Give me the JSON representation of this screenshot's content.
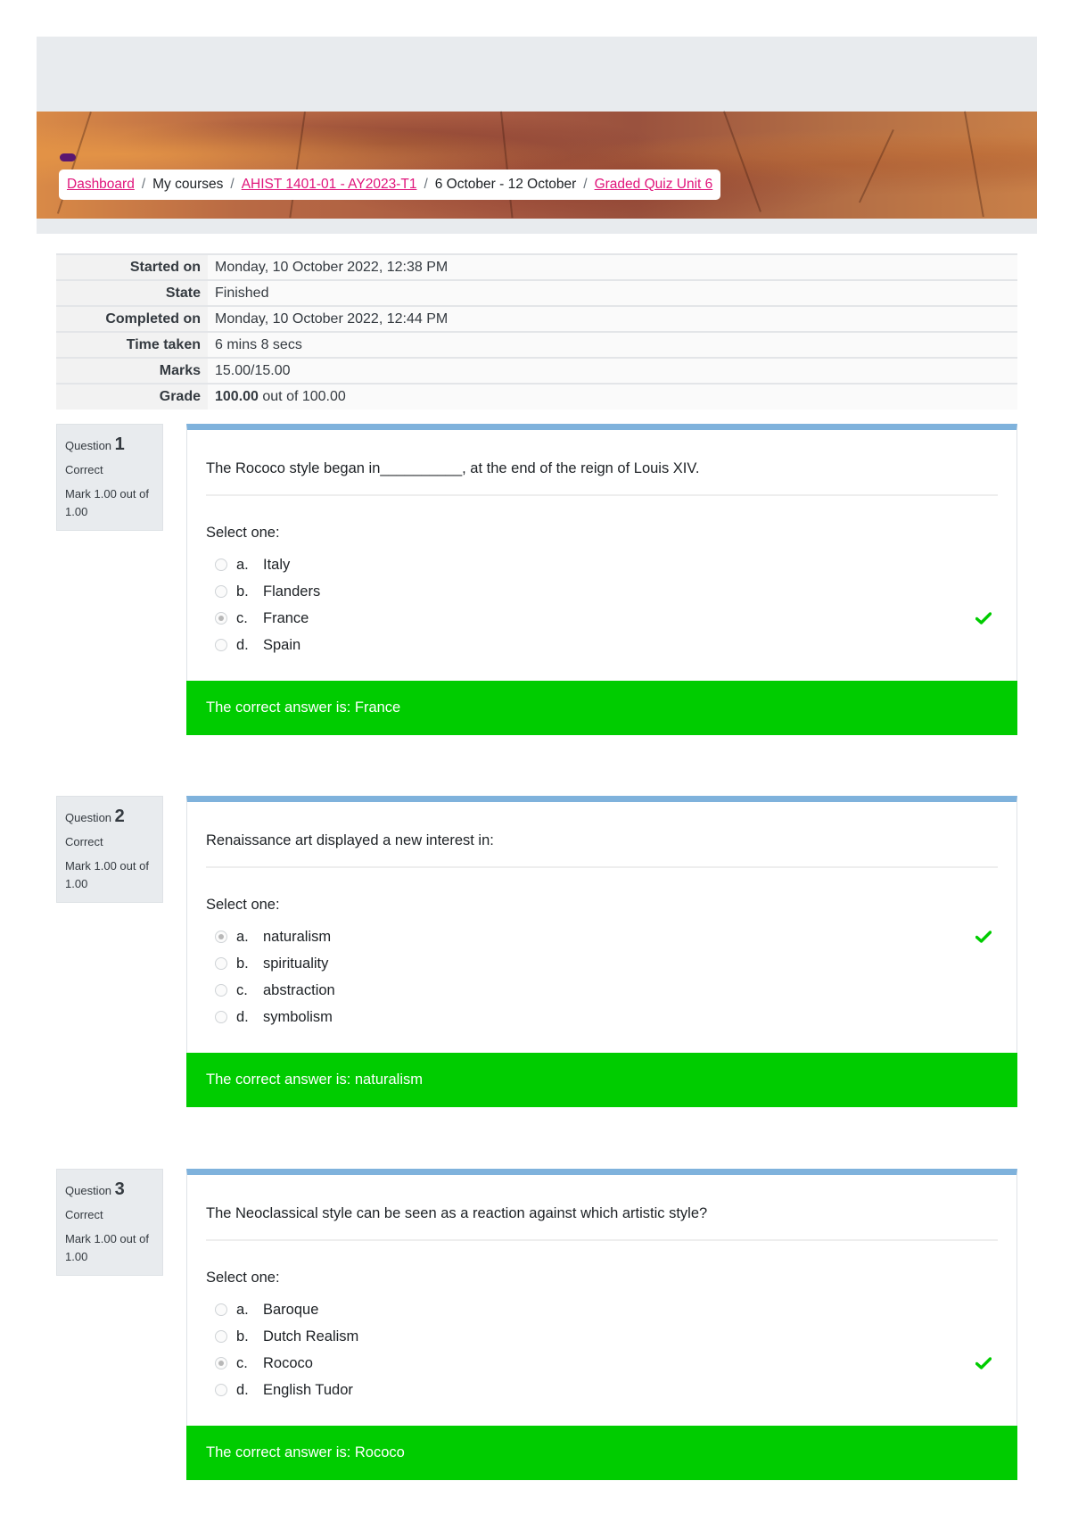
{
  "breadcrumb": {
    "items": [
      {
        "label": "Dashboard",
        "link": true
      },
      {
        "label": "My courses",
        "link": false
      },
      {
        "label": "AHIST 1401-01 - AY2023-T1",
        "link": true
      },
      {
        "label": "6 October - 12 October",
        "link": false
      },
      {
        "label": "Graded Quiz Unit 6",
        "link": true
      }
    ],
    "separator": "/"
  },
  "summary": {
    "rows": [
      {
        "label": "Started on",
        "value": "Monday, 10 October 2022, 12:38 PM"
      },
      {
        "label": "State",
        "value": "Finished"
      },
      {
        "label": "Completed on",
        "value": "Monday, 10 October 2022, 12:44 PM"
      },
      {
        "label": "Time taken",
        "value": "6 mins 8 secs"
      },
      {
        "label": "Marks",
        "value": "15.00/15.00"
      },
      {
        "label": "Grade",
        "value_bold": "100.00",
        "value": " out of 100.00"
      }
    ]
  },
  "questions": [
    {
      "label": "Question",
      "number": "1",
      "state": "Correct",
      "grade": "Mark 1.00 out of 1.00",
      "text": "The Rococo style began in__________, at the end of the reign of Louis XIV.",
      "prompt": "Select one:",
      "answers": [
        {
          "letter": "a.",
          "text": "Italy",
          "selected": false
        },
        {
          "letter": "b.",
          "text": "Flanders",
          "selected": false
        },
        {
          "letter": "c.",
          "text": "France",
          "selected": true
        },
        {
          "letter": "d.",
          "text": "Spain",
          "selected": false
        }
      ],
      "feedback": "The correct answer is: France"
    },
    {
      "label": "Question",
      "number": "2",
      "state": "Correct",
      "grade": "Mark 1.00 out of 1.00",
      "text": "Renaissance art displayed a new interest in:",
      "prompt": "Select one:",
      "answers": [
        {
          "letter": "a.",
          "text": "naturalism",
          "selected": true
        },
        {
          "letter": "b.",
          "text": "spirituality",
          "selected": false
        },
        {
          "letter": "c.",
          "text": "abstraction",
          "selected": false
        },
        {
          "letter": "d.",
          "text": "symbolism",
          "selected": false
        }
      ],
      "feedback": "The correct answer is: naturalism"
    },
    {
      "label": "Question",
      "number": "3",
      "state": "Correct",
      "grade": "Mark 1.00 out of 1.00",
      "text": "The Neoclassical style can be seen as a reaction against which artistic style?",
      "prompt": "Select one:",
      "answers": [
        {
          "letter": "a.",
          "text": "Baroque",
          "selected": false
        },
        {
          "letter": "b.",
          "text": "Dutch Realism",
          "selected": false
        },
        {
          "letter": "c.",
          "text": "Rococo",
          "selected": true
        },
        {
          "letter": "d.",
          "text": "English Tudor",
          "selected": false
        }
      ],
      "feedback": "The correct answer is: Rococo"
    }
  ],
  "colors": {
    "link": "#e0157b",
    "correct_feedback": "#00cc00",
    "check_icon": "#00cc00",
    "card_top_border": "#7fb2dc",
    "pill": "#5a1670"
  }
}
